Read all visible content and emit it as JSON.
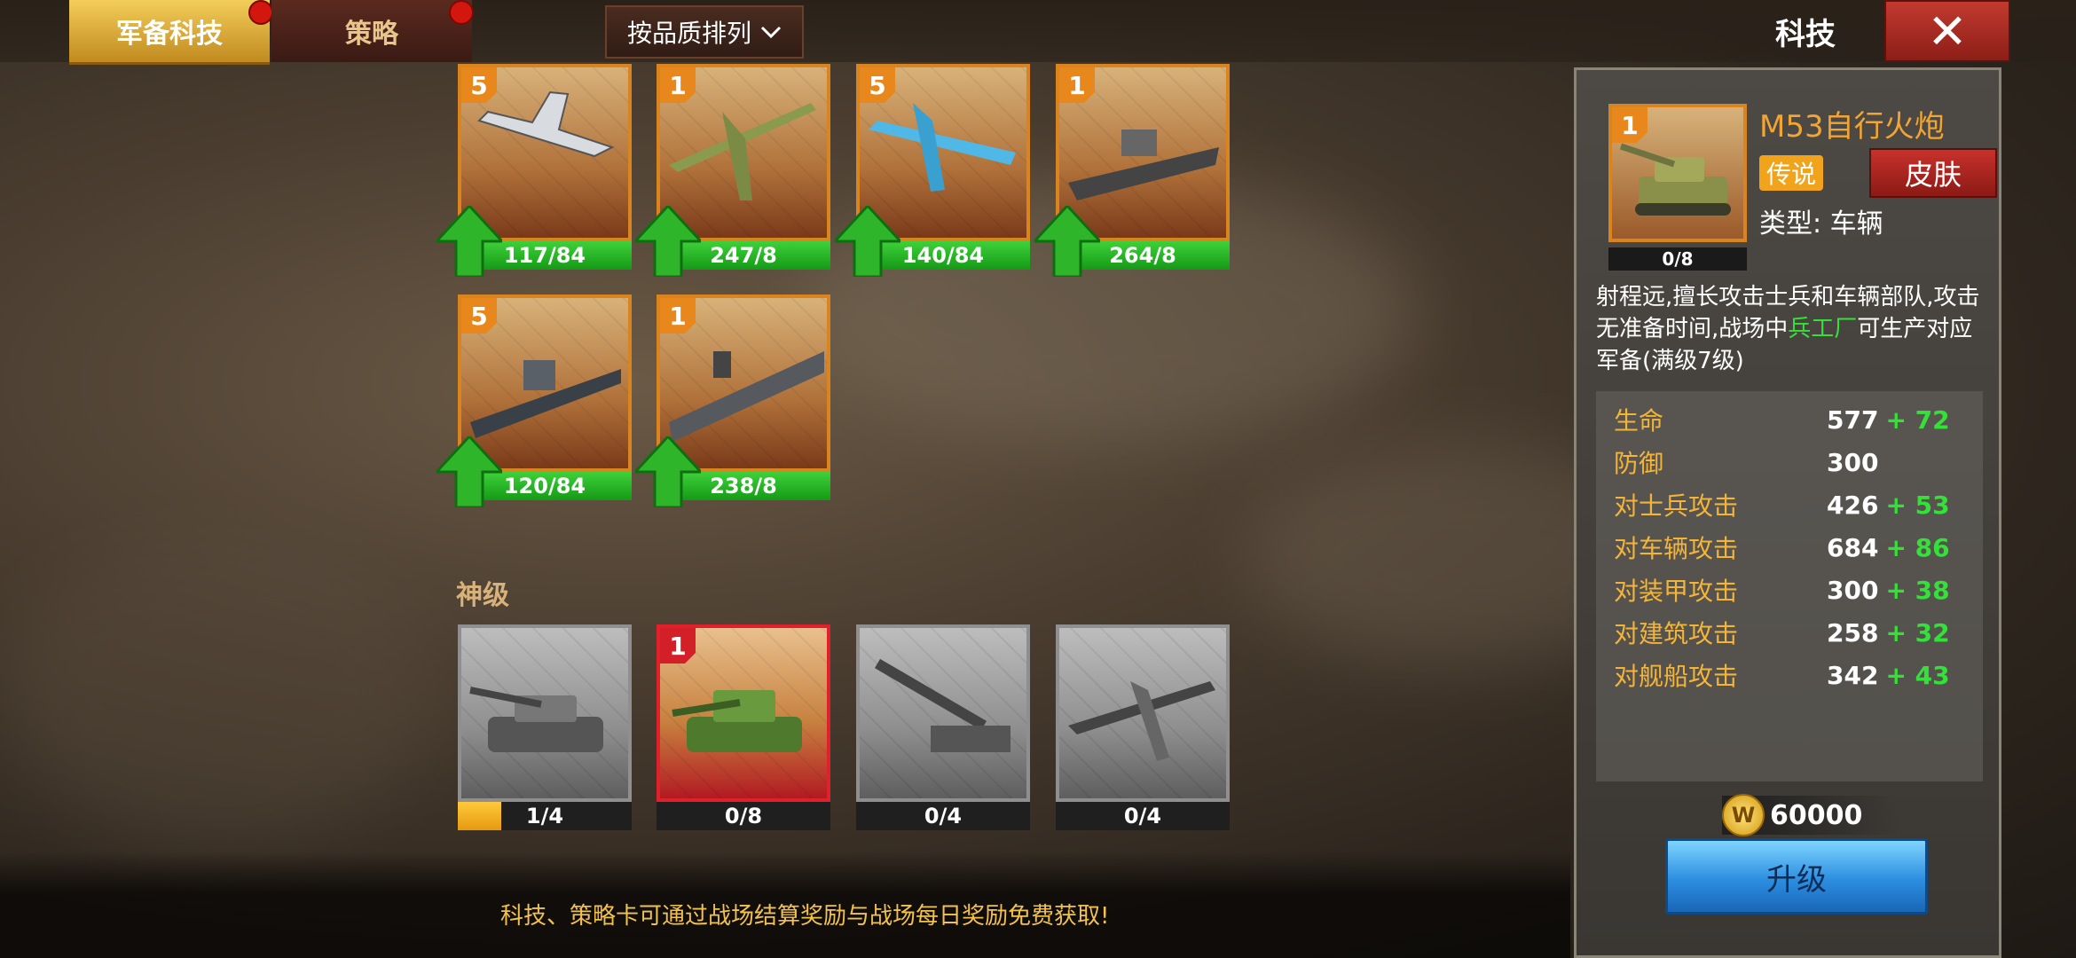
{
  "tabs": [
    {
      "label": "军备科技",
      "active": true
    },
    {
      "label": "策略",
      "active": false
    }
  ],
  "sort_label": "按品质排列",
  "title": "科技",
  "close_label": "✕",
  "cards_row1": [
    {
      "level": "5",
      "progress": "117/84",
      "kind": "jet"
    },
    {
      "level": "1",
      "progress": "247/8",
      "kind": "bomber"
    },
    {
      "level": "5",
      "progress": "140/84",
      "kind": "seaplane"
    },
    {
      "level": "1",
      "progress": "264/8",
      "kind": "battleship"
    }
  ],
  "cards_row2": [
    {
      "level": "5",
      "progress": "120/84",
      "kind": "cruiser"
    },
    {
      "level": "1",
      "progress": "238/8",
      "kind": "carrier"
    }
  ],
  "section_label": "神级",
  "cards_god": [
    {
      "level": "",
      "progress": "1/4",
      "fill_fraction": 0.25,
      "kind": "tank"
    },
    {
      "level": "1",
      "progress": "0/8",
      "fill_fraction": 0,
      "kind": "spg"
    },
    {
      "level": "",
      "progress": "0/4",
      "fill_fraction": 0,
      "kind": "artillery"
    },
    {
      "level": "",
      "progress": "0/4",
      "fill_fraction": 0,
      "kind": "fighter"
    }
  ],
  "footer_text": "科技、策略卡可通过战场结算奖励与战场每日奖励免费获取!",
  "detail": {
    "level": "1",
    "progress": "0/8",
    "name": "M53自行火炮",
    "rarity": "传说",
    "skin_label": "皮肤",
    "type_label": "类型: 车辆",
    "desc_before": "射程远,擅长攻击士兵和车辆部队,攻击无准备时间,战场中",
    "desc_highlight": "兵工厂",
    "desc_after": "可生产对应军备(满级7级)",
    "stats": [
      {
        "name": "生命",
        "value": "577",
        "plus": "+ 72"
      },
      {
        "name": "防御",
        "value": "300",
        "plus": ""
      },
      {
        "name": "对士兵攻击",
        "value": "426",
        "plus": "+ 53"
      },
      {
        "name": "对车辆攻击",
        "value": "684",
        "plus": "+ 86"
      },
      {
        "name": "对装甲攻击",
        "value": "300",
        "plus": "+ 38"
      },
      {
        "name": "对建筑攻击",
        "value": "258",
        "plus": "+ 32"
      },
      {
        "name": "对舰船攻击",
        "value": "342",
        "plus": "+ 43"
      }
    ],
    "cost": "60000",
    "coin_symbol": "W",
    "upgrade_label": "升级"
  },
  "colors": {
    "accent_gold": "#f2a534",
    "bonus_green": "#36e03a",
    "badge_orange": "#e8881c"
  }
}
